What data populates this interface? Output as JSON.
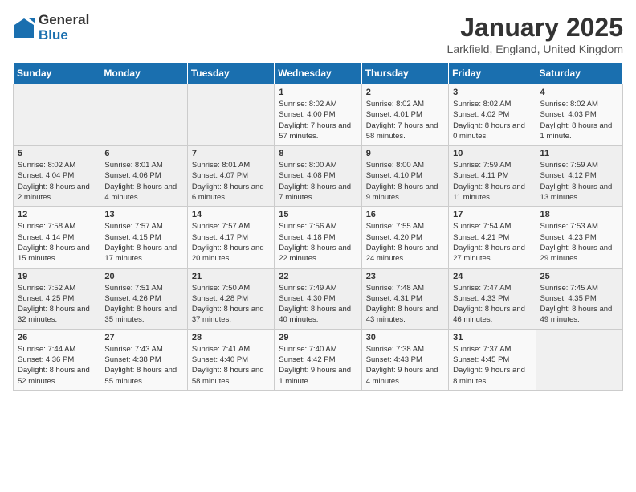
{
  "header": {
    "logo_general": "General",
    "logo_blue": "Blue",
    "title": "January 2025",
    "subtitle": "Larkfield, England, United Kingdom"
  },
  "weekdays": [
    "Sunday",
    "Monday",
    "Tuesday",
    "Wednesday",
    "Thursday",
    "Friday",
    "Saturday"
  ],
  "weeks": [
    [
      {
        "day": "",
        "text": ""
      },
      {
        "day": "",
        "text": ""
      },
      {
        "day": "",
        "text": ""
      },
      {
        "day": "1",
        "text": "Sunrise: 8:02 AM\nSunset: 4:00 PM\nDaylight: 7 hours and 57 minutes."
      },
      {
        "day": "2",
        "text": "Sunrise: 8:02 AM\nSunset: 4:01 PM\nDaylight: 7 hours and 58 minutes."
      },
      {
        "day": "3",
        "text": "Sunrise: 8:02 AM\nSunset: 4:02 PM\nDaylight: 8 hours and 0 minutes."
      },
      {
        "day": "4",
        "text": "Sunrise: 8:02 AM\nSunset: 4:03 PM\nDaylight: 8 hours and 1 minute."
      }
    ],
    [
      {
        "day": "5",
        "text": "Sunrise: 8:02 AM\nSunset: 4:04 PM\nDaylight: 8 hours and 2 minutes."
      },
      {
        "day": "6",
        "text": "Sunrise: 8:01 AM\nSunset: 4:06 PM\nDaylight: 8 hours and 4 minutes."
      },
      {
        "day": "7",
        "text": "Sunrise: 8:01 AM\nSunset: 4:07 PM\nDaylight: 8 hours and 6 minutes."
      },
      {
        "day": "8",
        "text": "Sunrise: 8:00 AM\nSunset: 4:08 PM\nDaylight: 8 hours and 7 minutes."
      },
      {
        "day": "9",
        "text": "Sunrise: 8:00 AM\nSunset: 4:10 PM\nDaylight: 8 hours and 9 minutes."
      },
      {
        "day": "10",
        "text": "Sunrise: 7:59 AM\nSunset: 4:11 PM\nDaylight: 8 hours and 11 minutes."
      },
      {
        "day": "11",
        "text": "Sunrise: 7:59 AM\nSunset: 4:12 PM\nDaylight: 8 hours and 13 minutes."
      }
    ],
    [
      {
        "day": "12",
        "text": "Sunrise: 7:58 AM\nSunset: 4:14 PM\nDaylight: 8 hours and 15 minutes."
      },
      {
        "day": "13",
        "text": "Sunrise: 7:57 AM\nSunset: 4:15 PM\nDaylight: 8 hours and 17 minutes."
      },
      {
        "day": "14",
        "text": "Sunrise: 7:57 AM\nSunset: 4:17 PM\nDaylight: 8 hours and 20 minutes."
      },
      {
        "day": "15",
        "text": "Sunrise: 7:56 AM\nSunset: 4:18 PM\nDaylight: 8 hours and 22 minutes."
      },
      {
        "day": "16",
        "text": "Sunrise: 7:55 AM\nSunset: 4:20 PM\nDaylight: 8 hours and 24 minutes."
      },
      {
        "day": "17",
        "text": "Sunrise: 7:54 AM\nSunset: 4:21 PM\nDaylight: 8 hours and 27 minutes."
      },
      {
        "day": "18",
        "text": "Sunrise: 7:53 AM\nSunset: 4:23 PM\nDaylight: 8 hours and 29 minutes."
      }
    ],
    [
      {
        "day": "19",
        "text": "Sunrise: 7:52 AM\nSunset: 4:25 PM\nDaylight: 8 hours and 32 minutes."
      },
      {
        "day": "20",
        "text": "Sunrise: 7:51 AM\nSunset: 4:26 PM\nDaylight: 8 hours and 35 minutes."
      },
      {
        "day": "21",
        "text": "Sunrise: 7:50 AM\nSunset: 4:28 PM\nDaylight: 8 hours and 37 minutes."
      },
      {
        "day": "22",
        "text": "Sunrise: 7:49 AM\nSunset: 4:30 PM\nDaylight: 8 hours and 40 minutes."
      },
      {
        "day": "23",
        "text": "Sunrise: 7:48 AM\nSunset: 4:31 PM\nDaylight: 8 hours and 43 minutes."
      },
      {
        "day": "24",
        "text": "Sunrise: 7:47 AM\nSunset: 4:33 PM\nDaylight: 8 hours and 46 minutes."
      },
      {
        "day": "25",
        "text": "Sunrise: 7:45 AM\nSunset: 4:35 PM\nDaylight: 8 hours and 49 minutes."
      }
    ],
    [
      {
        "day": "26",
        "text": "Sunrise: 7:44 AM\nSunset: 4:36 PM\nDaylight: 8 hours and 52 minutes."
      },
      {
        "day": "27",
        "text": "Sunrise: 7:43 AM\nSunset: 4:38 PM\nDaylight: 8 hours and 55 minutes."
      },
      {
        "day": "28",
        "text": "Sunrise: 7:41 AM\nSunset: 4:40 PM\nDaylight: 8 hours and 58 minutes."
      },
      {
        "day": "29",
        "text": "Sunrise: 7:40 AM\nSunset: 4:42 PM\nDaylight: 9 hours and 1 minute."
      },
      {
        "day": "30",
        "text": "Sunrise: 7:38 AM\nSunset: 4:43 PM\nDaylight: 9 hours and 4 minutes."
      },
      {
        "day": "31",
        "text": "Sunrise: 7:37 AM\nSunset: 4:45 PM\nDaylight: 9 hours and 8 minutes."
      },
      {
        "day": "",
        "text": ""
      }
    ]
  ]
}
